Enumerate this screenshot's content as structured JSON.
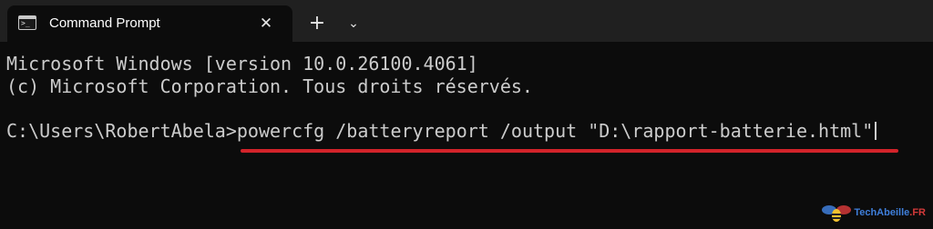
{
  "window": {
    "tab_title": "Command Prompt",
    "tab_icon": "cmd-icon",
    "close_icon": "close-icon",
    "new_tab_icon": "plus-icon",
    "dropdown_icon": "chevron-down-icon"
  },
  "terminal": {
    "line1": "Microsoft Windows [version 10.0.26100.4061]",
    "line2": "(c) Microsoft Corporation. Tous droits réservés.",
    "prompt": "C:\\Users\\RobertAbela>",
    "command": "powercfg /batteryreport /output \"D:\\rapport-batterie.html\""
  },
  "highlight": {
    "color": "#d2232a"
  },
  "watermark": {
    "brand": "TechAbeille",
    "suffix": ".FR",
    "logo": "bee-icon"
  },
  "colors": {
    "background": "#0c0c0c",
    "titlebar": "#202020",
    "text": "#cccccc"
  }
}
